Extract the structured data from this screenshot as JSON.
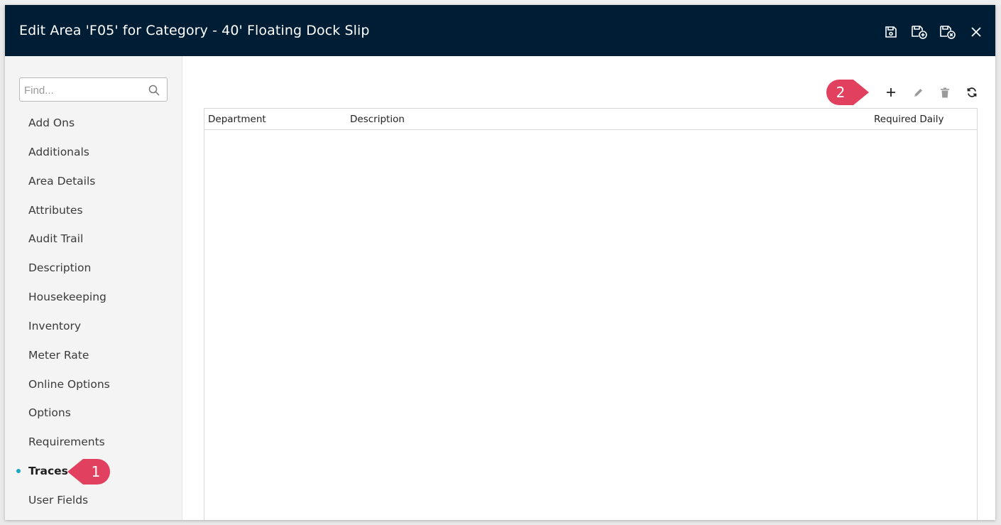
{
  "window": {
    "title": "Edit Area 'F05' for Category - 40' Floating Dock Slip",
    "actions": [
      {
        "icon": "save-icon"
      },
      {
        "icon": "save-and-new-icon"
      },
      {
        "icon": "save-and-close-icon"
      },
      {
        "icon": "close-icon"
      }
    ]
  },
  "sidebar": {
    "search": {
      "placeholder": "Find...",
      "value": ""
    },
    "items": [
      {
        "label": "Add Ons"
      },
      {
        "label": "Additionals"
      },
      {
        "label": "Area Details"
      },
      {
        "label": "Attributes"
      },
      {
        "label": "Audit Trail"
      },
      {
        "label": "Description"
      },
      {
        "label": "Housekeeping"
      },
      {
        "label": "Inventory"
      },
      {
        "label": "Meter Rate"
      },
      {
        "label": "Online Options"
      },
      {
        "label": "Options"
      },
      {
        "label": "Requirements"
      },
      {
        "label": "Traces",
        "active": true
      },
      {
        "label": "User Fields"
      }
    ]
  },
  "toolbar": {
    "buttons": [
      {
        "icon": "add-icon"
      },
      {
        "icon": "edit-icon"
      },
      {
        "icon": "delete-icon"
      },
      {
        "icon": "refresh-icon"
      }
    ]
  },
  "grid": {
    "columns": [
      "Department",
      "Description",
      "Required Daily"
    ],
    "rows": []
  },
  "callouts": [
    {
      "number": "1"
    },
    {
      "number": "2"
    }
  ],
  "colors": {
    "titlebar": "#001d36",
    "callout": "#e2405f",
    "active_dot": "#1aa6c8"
  }
}
